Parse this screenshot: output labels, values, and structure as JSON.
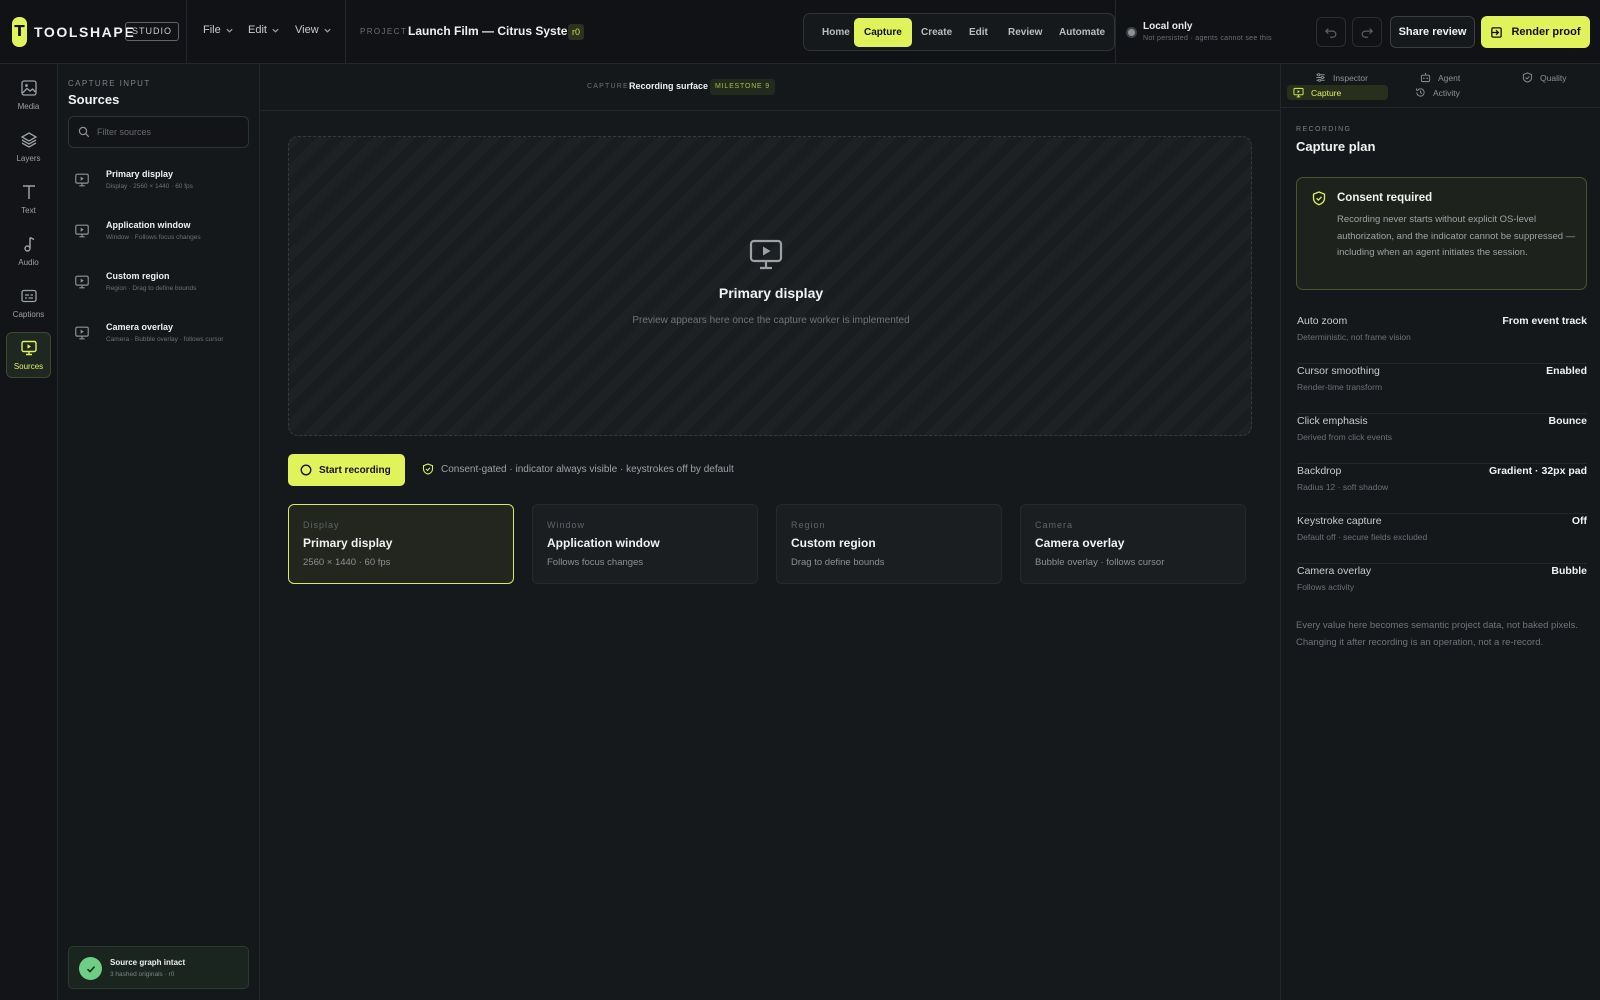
{
  "app": {
    "logo_letter": "T",
    "name": "TOOLSHAPE",
    "edition": "STUDIO"
  },
  "menu": [
    {
      "label": "File",
      "icon": "chevron-down-icon"
    },
    {
      "label": "Edit",
      "icon": "chevron-down-icon"
    },
    {
      "label": "View",
      "icon": "chevron-down-icon"
    }
  ],
  "project": {
    "label": "PROJECT",
    "name": "Launch Film — Citrus System",
    "revision": "r0"
  },
  "nav": {
    "items": [
      "Home",
      "Capture",
      "Create",
      "Edit",
      "Review",
      "Automate"
    ],
    "active": "Capture"
  },
  "storage": {
    "title": "Local only",
    "subtitle": "Not persisted · agents cannot see this"
  },
  "toolbar": {
    "undo_icon": "undo-icon",
    "redo_icon": "redo-icon",
    "share_label": "Share review",
    "render_label": "Render proof"
  },
  "rail": {
    "items": [
      {
        "label": "Media",
        "icon": "image-icon"
      },
      {
        "label": "Layers",
        "icon": "layers-icon"
      },
      {
        "label": "Text",
        "icon": "text-icon"
      },
      {
        "label": "Audio",
        "icon": "music-note-icon"
      },
      {
        "label": "Captions",
        "icon": "captions-icon"
      },
      {
        "label": "Sources",
        "icon": "screen-play-icon"
      }
    ],
    "active": "Sources"
  },
  "sources_panel": {
    "kicker": "CAPTURE INPUT",
    "title": "Sources",
    "filter_placeholder": "Filter sources",
    "items": [
      {
        "name": "Primary display",
        "detail": "Display · 2560 × 1440 · 60 fps"
      },
      {
        "name": "Application window",
        "detail": "Window · Follows focus changes"
      },
      {
        "name": "Custom region",
        "detail": "Region · Drag to define bounds"
      },
      {
        "name": "Camera overlay",
        "detail": "Camera · Bubble overlay · follows cursor"
      }
    ],
    "status": {
      "title": "Source graph intact",
      "detail": "3 hashed originals · r0"
    }
  },
  "main": {
    "header": {
      "kicker": "CAPTURE",
      "surface": "Recording surface",
      "milestone": "MILESTONE 9"
    },
    "preview": {
      "title": "Primary display",
      "subtitle": "Preview appears here once the capture worker is implemented"
    },
    "record_button": "Start recording",
    "consent_note": "Consent-gated · indicator always visible · keystrokes off by default",
    "cards": [
      {
        "kicker": "Display",
        "title": "Primary display",
        "detail": "2560 × 1440 · 60 fps",
        "selected": true
      },
      {
        "kicker": "Window",
        "title": "Application window",
        "detail": "Follows focus changes",
        "selected": false
      },
      {
        "kicker": "Region",
        "title": "Custom region",
        "detail": "Drag to define bounds",
        "selected": false
      },
      {
        "kicker": "Camera",
        "title": "Camera overlay",
        "detail": "Bubble overlay · follows cursor",
        "selected": false
      }
    ]
  },
  "inspector": {
    "tabs": [
      {
        "label": "Inspector",
        "icon": "sliders-icon"
      },
      {
        "label": "Agent",
        "icon": "robot-icon"
      },
      {
        "label": "Quality",
        "icon": "shield-check-icon"
      },
      {
        "label": "Capture",
        "icon": "screen-play-icon"
      },
      {
        "label": "Activity",
        "icon": "history-icon"
      }
    ],
    "active_tab": "Capture",
    "kicker": "RECORDING",
    "title": "Capture plan",
    "consent": {
      "title": "Consent required",
      "body": "Recording never starts without explicit OS-level authorization, and the indicator cannot be suppressed — including when an agent initiates the session."
    },
    "settings": [
      {
        "label": "Auto zoom",
        "sub": "Deterministic, not frame vision",
        "value": "From event track"
      },
      {
        "label": "Cursor smoothing",
        "sub": "Render-time transform",
        "value": "Enabled"
      },
      {
        "label": "Click emphasis",
        "sub": "Derived from click events",
        "value": "Bounce"
      },
      {
        "label": "Backdrop",
        "sub": "Radius 12 · soft shadow",
        "value": "Gradient · 32px pad"
      },
      {
        "label": "Keystroke capture",
        "sub": "Default off · secure fields excluded",
        "value": "Off"
      },
      {
        "label": "Camera overlay",
        "sub": "Follows activity",
        "value": "Bubble"
      }
    ],
    "footnote": "Every value here becomes semantic project data, not baked pixels. Changing it after recording is an operation, not a re-record."
  },
  "colors": {
    "accent": "#e0f35a",
    "background": "#15181b",
    "success": "#6fce86"
  }
}
